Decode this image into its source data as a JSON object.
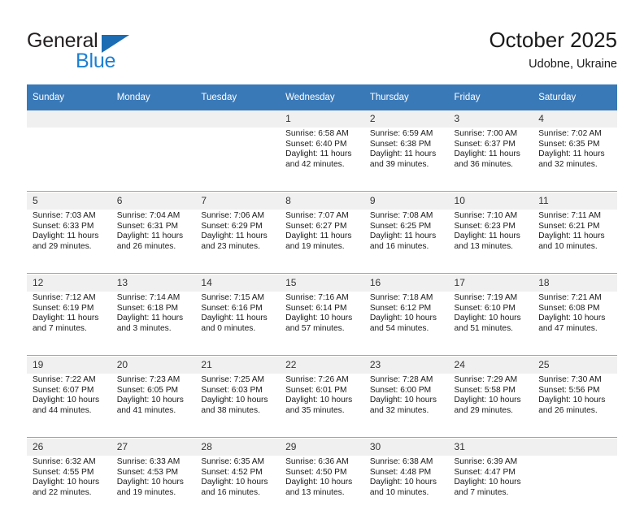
{
  "brand": {
    "name_top": "General",
    "name_bottom": "Blue",
    "triangle_color": "#1b6cb3",
    "blue_color": "#1b7fd4"
  },
  "header": {
    "title": "October 2025",
    "subtitle": "Udobne, Ukraine",
    "header_bg": "#3a79b8",
    "daynum_bg": "#f0f0f0"
  },
  "weekday_headers": [
    "Sunday",
    "Monday",
    "Tuesday",
    "Wednesday",
    "Thursday",
    "Friday",
    "Saturday"
  ],
  "weeks": [
    {
      "days": [
        {
          "num": "",
          "lines": []
        },
        {
          "num": "",
          "lines": []
        },
        {
          "num": "",
          "lines": []
        },
        {
          "num": "1",
          "lines": [
            "Sunrise: 6:58 AM",
            "Sunset: 6:40 PM",
            "Daylight: 11 hours",
            "and 42 minutes."
          ]
        },
        {
          "num": "2",
          "lines": [
            "Sunrise: 6:59 AM",
            "Sunset: 6:38 PM",
            "Daylight: 11 hours",
            "and 39 minutes."
          ]
        },
        {
          "num": "3",
          "lines": [
            "Sunrise: 7:00 AM",
            "Sunset: 6:37 PM",
            "Daylight: 11 hours",
            "and 36 minutes."
          ]
        },
        {
          "num": "4",
          "lines": [
            "Sunrise: 7:02 AM",
            "Sunset: 6:35 PM",
            "Daylight: 11 hours",
            "and 32 minutes."
          ]
        }
      ]
    },
    {
      "days": [
        {
          "num": "5",
          "lines": [
            "Sunrise: 7:03 AM",
            "Sunset: 6:33 PM",
            "Daylight: 11 hours",
            "and 29 minutes."
          ]
        },
        {
          "num": "6",
          "lines": [
            "Sunrise: 7:04 AM",
            "Sunset: 6:31 PM",
            "Daylight: 11 hours",
            "and 26 minutes."
          ]
        },
        {
          "num": "7",
          "lines": [
            "Sunrise: 7:06 AM",
            "Sunset: 6:29 PM",
            "Daylight: 11 hours",
            "and 23 minutes."
          ]
        },
        {
          "num": "8",
          "lines": [
            "Sunrise: 7:07 AM",
            "Sunset: 6:27 PM",
            "Daylight: 11 hours",
            "and 19 minutes."
          ]
        },
        {
          "num": "9",
          "lines": [
            "Sunrise: 7:08 AM",
            "Sunset: 6:25 PM",
            "Daylight: 11 hours",
            "and 16 minutes."
          ]
        },
        {
          "num": "10",
          "lines": [
            "Sunrise: 7:10 AM",
            "Sunset: 6:23 PM",
            "Daylight: 11 hours",
            "and 13 minutes."
          ]
        },
        {
          "num": "11",
          "lines": [
            "Sunrise: 7:11 AM",
            "Sunset: 6:21 PM",
            "Daylight: 11 hours",
            "and 10 minutes."
          ]
        }
      ]
    },
    {
      "days": [
        {
          "num": "12",
          "lines": [
            "Sunrise: 7:12 AM",
            "Sunset: 6:19 PM",
            "Daylight: 11 hours",
            "and 7 minutes."
          ]
        },
        {
          "num": "13",
          "lines": [
            "Sunrise: 7:14 AM",
            "Sunset: 6:18 PM",
            "Daylight: 11 hours",
            "and 3 minutes."
          ]
        },
        {
          "num": "14",
          "lines": [
            "Sunrise: 7:15 AM",
            "Sunset: 6:16 PM",
            "Daylight: 11 hours",
            "and 0 minutes."
          ]
        },
        {
          "num": "15",
          "lines": [
            "Sunrise: 7:16 AM",
            "Sunset: 6:14 PM",
            "Daylight: 10 hours",
            "and 57 minutes."
          ]
        },
        {
          "num": "16",
          "lines": [
            "Sunrise: 7:18 AM",
            "Sunset: 6:12 PM",
            "Daylight: 10 hours",
            "and 54 minutes."
          ]
        },
        {
          "num": "17",
          "lines": [
            "Sunrise: 7:19 AM",
            "Sunset: 6:10 PM",
            "Daylight: 10 hours",
            "and 51 minutes."
          ]
        },
        {
          "num": "18",
          "lines": [
            "Sunrise: 7:21 AM",
            "Sunset: 6:08 PM",
            "Daylight: 10 hours",
            "and 47 minutes."
          ]
        }
      ]
    },
    {
      "days": [
        {
          "num": "19",
          "lines": [
            "Sunrise: 7:22 AM",
            "Sunset: 6:07 PM",
            "Daylight: 10 hours",
            "and 44 minutes."
          ]
        },
        {
          "num": "20",
          "lines": [
            "Sunrise: 7:23 AM",
            "Sunset: 6:05 PM",
            "Daylight: 10 hours",
            "and 41 minutes."
          ]
        },
        {
          "num": "21",
          "lines": [
            "Sunrise: 7:25 AM",
            "Sunset: 6:03 PM",
            "Daylight: 10 hours",
            "and 38 minutes."
          ]
        },
        {
          "num": "22",
          "lines": [
            "Sunrise: 7:26 AM",
            "Sunset: 6:01 PM",
            "Daylight: 10 hours",
            "and 35 minutes."
          ]
        },
        {
          "num": "23",
          "lines": [
            "Sunrise: 7:28 AM",
            "Sunset: 6:00 PM",
            "Daylight: 10 hours",
            "and 32 minutes."
          ]
        },
        {
          "num": "24",
          "lines": [
            "Sunrise: 7:29 AM",
            "Sunset: 5:58 PM",
            "Daylight: 10 hours",
            "and 29 minutes."
          ]
        },
        {
          "num": "25",
          "lines": [
            "Sunrise: 7:30 AM",
            "Sunset: 5:56 PM",
            "Daylight: 10 hours",
            "and 26 minutes."
          ]
        }
      ]
    },
    {
      "days": [
        {
          "num": "26",
          "lines": [
            "Sunrise: 6:32 AM",
            "Sunset: 4:55 PM",
            "Daylight: 10 hours",
            "and 22 minutes."
          ]
        },
        {
          "num": "27",
          "lines": [
            "Sunrise: 6:33 AM",
            "Sunset: 4:53 PM",
            "Daylight: 10 hours",
            "and 19 minutes."
          ]
        },
        {
          "num": "28",
          "lines": [
            "Sunrise: 6:35 AM",
            "Sunset: 4:52 PM",
            "Daylight: 10 hours",
            "and 16 minutes."
          ]
        },
        {
          "num": "29",
          "lines": [
            "Sunrise: 6:36 AM",
            "Sunset: 4:50 PM",
            "Daylight: 10 hours",
            "and 13 minutes."
          ]
        },
        {
          "num": "30",
          "lines": [
            "Sunrise: 6:38 AM",
            "Sunset: 4:48 PM",
            "Daylight: 10 hours",
            "and 10 minutes."
          ]
        },
        {
          "num": "31",
          "lines": [
            "Sunrise: 6:39 AM",
            "Sunset: 4:47 PM",
            "Daylight: 10 hours",
            "and 7 minutes."
          ]
        },
        {
          "num": "",
          "lines": []
        }
      ]
    }
  ]
}
